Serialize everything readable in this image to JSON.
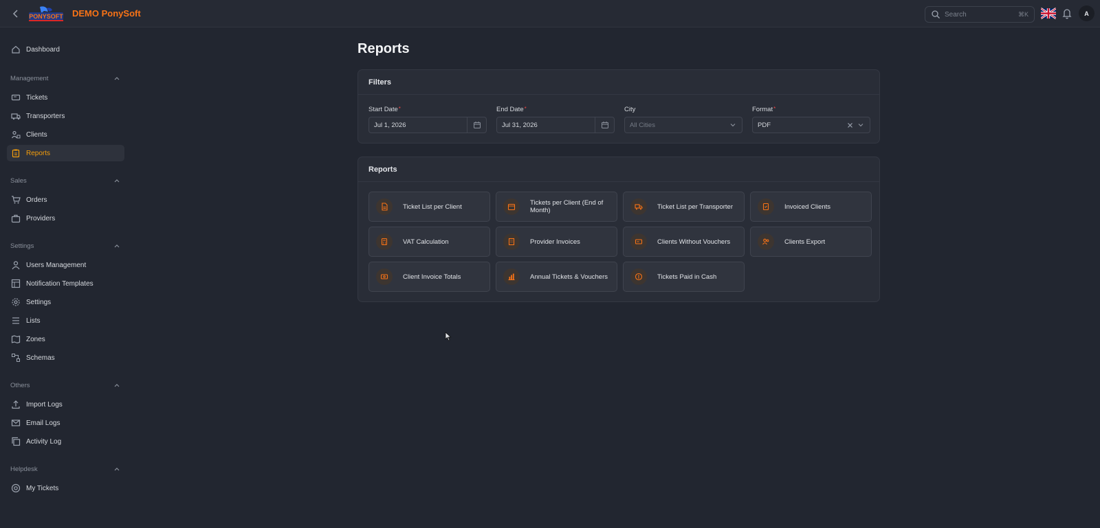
{
  "topbar": {
    "brand": "DEMO PonySoft",
    "logo_text": "PONYSOFT",
    "search": {
      "placeholder": "Search",
      "shortcut": "⌘K"
    },
    "avatar": "A",
    "icons": [
      "chevron-left-icon",
      "uk-flag-icon",
      "bell-icon"
    ]
  },
  "sidebar": {
    "dashboard": "Dashboard",
    "sections": [
      {
        "label": "Management",
        "items": [
          "Tickets",
          "Transporters",
          "Clients",
          "Reports"
        ]
      },
      {
        "label": "Sales",
        "items": [
          "Orders",
          "Providers"
        ]
      },
      {
        "label": "Settings",
        "items": [
          "Users Management",
          "Notification Templates",
          "Settings",
          "Lists",
          "Zones",
          "Schemas"
        ]
      },
      {
        "label": "Others",
        "items": [
          "Import Logs",
          "Email Logs",
          "Activity Log"
        ]
      },
      {
        "label": "Helpdesk",
        "items": [
          "My Tickets"
        ]
      }
    ],
    "active_item": "Reports"
  },
  "page": {
    "title": "Reports"
  },
  "filters": {
    "title": "Filters",
    "start_date": {
      "label": "Start Date",
      "required": "*",
      "value": "Jul 1, 2026"
    },
    "end_date": {
      "label": "End Date",
      "required": "*",
      "value": "Jul 31, 2026"
    },
    "city": {
      "label": "City",
      "placeholder": "All Cities"
    },
    "format": {
      "label": "Format",
      "required": "*",
      "value": "PDF"
    }
  },
  "reports": {
    "title": "Reports",
    "items": [
      "Ticket List per Client",
      "Tickets per Client (End of Month)",
      "Ticket List per Transporter",
      "Invoiced Clients",
      "VAT Calculation",
      "Provider Invoices",
      "Clients Without Vouchers",
      "Clients Export",
      "Client Invoice Totals",
      "Annual Tickets & Vouchers",
      "Tickets Paid in Cash"
    ]
  },
  "colors": {
    "accent": "#f97316",
    "active_text": "#f59e0b",
    "background": "#222630",
    "card": "#292d37"
  }
}
